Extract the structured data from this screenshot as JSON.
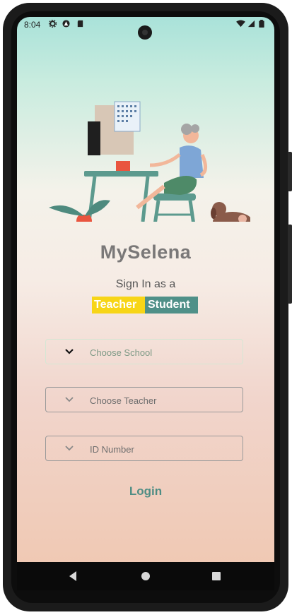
{
  "status_bar": {
    "time": "8:04",
    "left_icons": [
      "gear-icon",
      "app-badge-icon",
      "sd-card-icon"
    ],
    "right_icons": [
      "wifi-icon",
      "signal-icon",
      "battery-icon"
    ]
  },
  "app": {
    "title": "MySelena",
    "signin_prompt": "Sign In as a",
    "roles": {
      "teacher": "Teacher",
      "student": "Student"
    },
    "selected_role": "Student"
  },
  "form": {
    "school": {
      "label": "Choose School",
      "icon": "chevron-down-icon"
    },
    "teacher": {
      "label": "Choose Teacher",
      "icon": "chevron-down-icon"
    },
    "id_number": {
      "label": "ID Number",
      "icon": "chevron-down-icon"
    }
  },
  "actions": {
    "login_label": "Login"
  },
  "nav": {
    "back": "back-icon",
    "home": "home-icon",
    "recents": "recents-icon"
  },
  "colors": {
    "teacher_bg": "#f7d517",
    "student_bg": "#4f9088",
    "accent": "#4e8d84",
    "title": "#7a7878"
  }
}
